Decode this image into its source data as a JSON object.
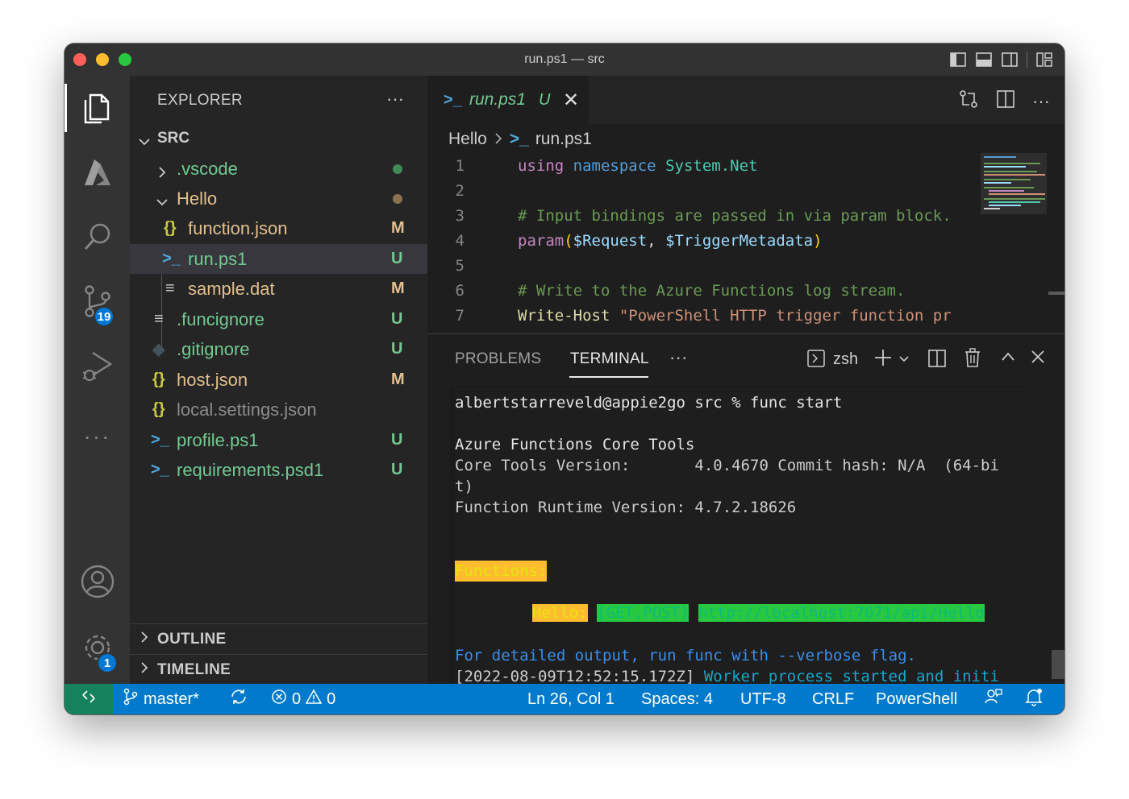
{
  "window": {
    "title": "run.ps1 — src"
  },
  "activity_bar": {
    "items": [
      {
        "icon": "explorer-icon",
        "active": true
      },
      {
        "icon": "azure-icon"
      },
      {
        "icon": "search-icon"
      },
      {
        "icon": "source-control-icon",
        "badge": "19"
      },
      {
        "icon": "run-debug-icon"
      },
      {
        "icon": "more-icon"
      },
      {
        "icon": "account-icon"
      },
      {
        "icon": "settings-gear-icon",
        "badge": "1"
      }
    ],
    "scm_badge": "19",
    "settings_badge": "1"
  },
  "sidebar": {
    "title": "EXPLORER",
    "more": "···",
    "root": "SRC",
    "tree": [
      {
        "name": ".vscode",
        "kind": "folder",
        "collapsed": true,
        "status": "",
        "dot": "#3f8a57",
        "color": "#73c991"
      },
      {
        "name": "Hello",
        "kind": "folder",
        "collapsed": false,
        "status": "",
        "dot": "#8a7250",
        "color": "#e2c08d"
      },
      {
        "name": "function.json",
        "kind": "json",
        "status": "M",
        "color": "#e2c08d",
        "status_color": "#e2c08d"
      },
      {
        "name": "run.ps1",
        "kind": "ps1",
        "status": "U",
        "color": "#73c991",
        "status_color": "#73c991",
        "selected": true
      },
      {
        "name": "sample.dat",
        "kind": "text",
        "status": "M",
        "color": "#e2c08d",
        "status_color": "#e2c08d"
      },
      {
        "name": ".funcignore",
        "kind": "text",
        "status": "U",
        "color": "#73c991",
        "status_color": "#73c991"
      },
      {
        "name": ".gitignore",
        "kind": "git",
        "status": "U",
        "color": "#73c991",
        "status_color": "#73c991"
      },
      {
        "name": "host.json",
        "kind": "json",
        "status": "M",
        "color": "#e2c08d",
        "status_color": "#e2c08d"
      },
      {
        "name": "local.settings.json",
        "kind": "json",
        "status": "",
        "color": "#8c8c8c"
      },
      {
        "name": "profile.ps1",
        "kind": "ps1",
        "status": "U",
        "color": "#73c991",
        "status_color": "#73c991"
      },
      {
        "name": "requirements.psd1",
        "kind": "ps1",
        "status": "U",
        "color": "#73c991",
        "status_color": "#73c991"
      }
    ],
    "sections": [
      "OUTLINE",
      "TIMELINE"
    ]
  },
  "editor": {
    "tab": {
      "name": "run.ps1",
      "status": "U",
      "close": "✕"
    },
    "breadcrumb": {
      "folder": "Hello",
      "file": "run.ps1"
    },
    "lines": [
      {
        "n": "1"
      },
      {
        "n": "2"
      },
      {
        "n": "3"
      },
      {
        "n": "4"
      },
      {
        "n": "5"
      },
      {
        "n": "6"
      },
      {
        "n": "7"
      }
    ],
    "code": {
      "l1_kw": "using",
      "l1_kw2": "namespace",
      "l1_ns": "System.Net",
      "l3": "# Input bindings are passed in via param block.",
      "l4_kw": "param",
      "l4_open": "(",
      "l4_v1": "$Request",
      "l4_sep": ", ",
      "l4_v2": "$TriggerMetadata",
      "l4_close": ")",
      "l6": "# Write to the Azure Functions log stream.",
      "l7_fn": "Write-Host",
      "l7_str": " \"PowerShell HTTP trigger function pr"
    }
  },
  "panel": {
    "tabs": [
      "PROBLEMS",
      "TERMINAL"
    ],
    "active_tab": "TERMINAL",
    "more": "···",
    "shell": "zsh",
    "terminal": {
      "prompt": "albertstarreveld@appie2go src % func start",
      "tool_title": "Azure Functions Core Tools",
      "version": "Core Tools Version:       4.0.4670 Commit hash: N/A  (64-bi",
      "version_wrap": "t)",
      "runtime": "Function Runtime Version: 4.7.2.18626",
      "functions_header": "Functions:",
      "fn_name": "Hello:",
      "fn_methods": "[GET,POST]",
      "fn_url": "http://localhost:7071/api/Hello",
      "detail": "For detailed output, run func with --verbose flag.",
      "log_ts": "[2022-08-09T12:52:15.172Z]",
      "log_msg": " Worker process started and initi"
    }
  },
  "status_bar": {
    "branch": "master*",
    "errors": "0",
    "warnings": "0",
    "position": "Ln 26, Col 1",
    "spaces": "Spaces: 4",
    "encoding": "UTF-8",
    "eol": "CRLF",
    "language": "PowerShell"
  },
  "colors": {
    "accent": "#007acc",
    "remote": "#16825d",
    "untracked": "#73c991",
    "modified": "#e2c08d"
  }
}
